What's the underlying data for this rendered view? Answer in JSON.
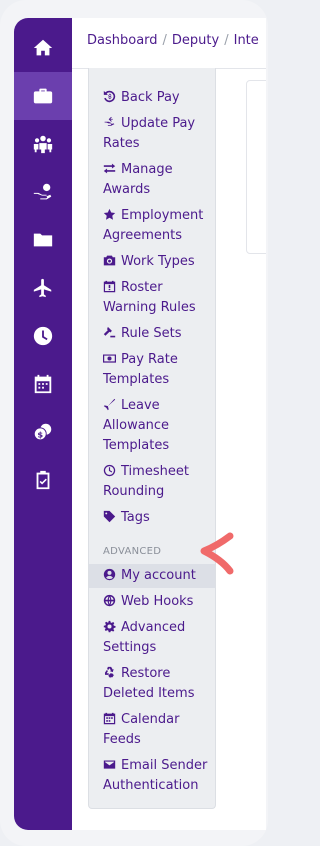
{
  "rail": {
    "items": [
      {
        "icon": "home-icon"
      },
      {
        "icon": "briefcase-icon"
      },
      {
        "icon": "people-icon"
      },
      {
        "icon": "hand-money-icon"
      },
      {
        "icon": "folder-icon"
      },
      {
        "icon": "airplane-icon"
      },
      {
        "icon": "clock-icon"
      },
      {
        "icon": "calendar-icon"
      },
      {
        "icon": "coins-icon"
      },
      {
        "icon": "clipboard-check-icon"
      }
    ],
    "active_index": 1
  },
  "breadcrumb": {
    "items": [
      "Dashboard",
      "Deputy",
      "Inte"
    ]
  },
  "menu": {
    "items": [
      {
        "label": "Back Pay",
        "icon": "back-pay-icon"
      },
      {
        "label": "Update Pay Rates",
        "icon": "update-pay-icon"
      },
      {
        "label": "Manage Awards",
        "icon": "exchange-icon"
      },
      {
        "label": "Employment Agreements",
        "icon": "star-icon"
      },
      {
        "label": "Work Types",
        "icon": "camera-icon"
      },
      {
        "label": "Roster Warning Rules",
        "icon": "calendar-warning-icon"
      },
      {
        "label": "Rule Sets",
        "icon": "gavel-icon"
      },
      {
        "label": "Pay Rate Templates",
        "icon": "money-icon"
      },
      {
        "label": "Leave Allowance Templates",
        "icon": "plane-icon"
      },
      {
        "label": "Timesheet Rounding",
        "icon": "clock-small-icon"
      },
      {
        "label": "Tags",
        "icon": "tag-icon"
      }
    ],
    "section_label": "ADVANCED",
    "advanced_items": [
      {
        "label": "My account",
        "icon": "user-circle-icon",
        "highlighted": true
      },
      {
        "label": "Web Hooks",
        "icon": "globe-icon"
      },
      {
        "label": "Advanced Settings",
        "icon": "cog-icon"
      },
      {
        "label": "Restore Deleted Items",
        "icon": "recycle-icon"
      },
      {
        "label": "Calendar Feeds",
        "icon": "calendar-small-icon"
      },
      {
        "label": "Email Sender Authentication",
        "icon": "envelope-icon"
      }
    ]
  },
  "colors": {
    "rail": "#4b1a8c",
    "rail_active": "#6b3fae",
    "menu_text": "#4b1a8c",
    "annotation_arrow": "#f06a6a"
  }
}
